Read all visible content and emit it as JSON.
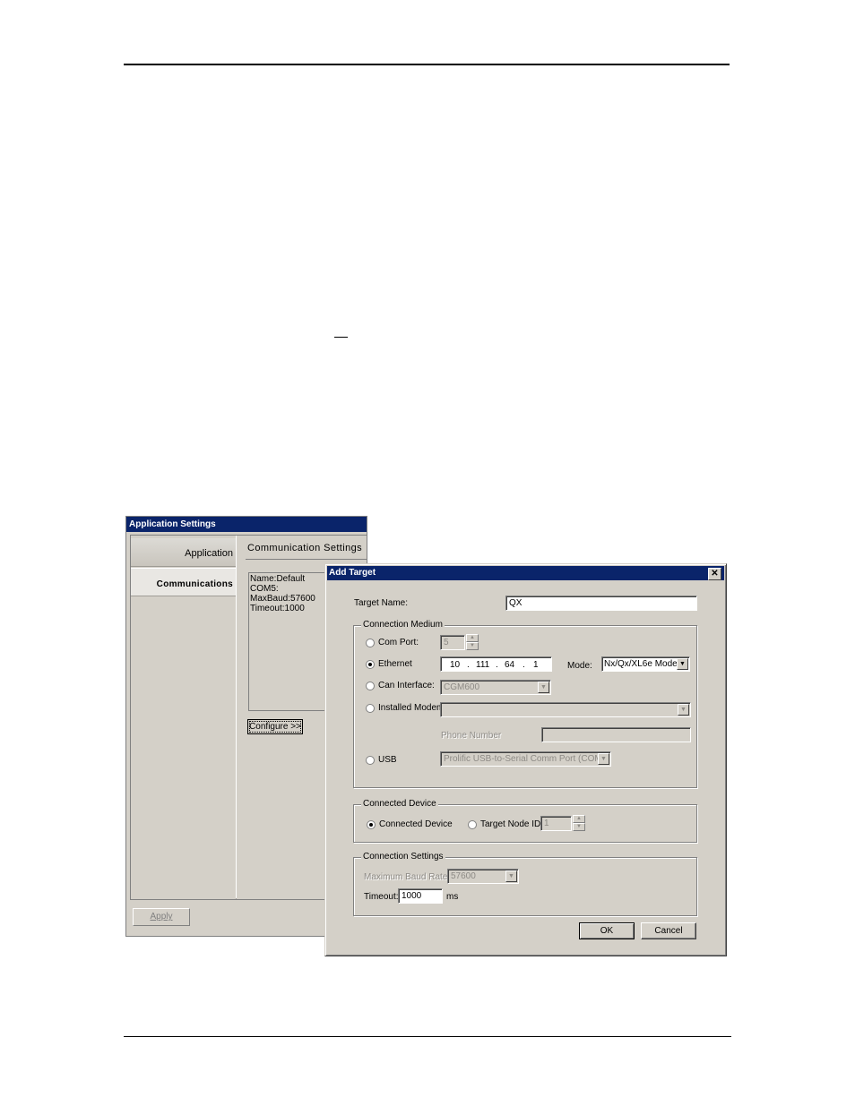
{
  "app_settings": {
    "title": "Application Settings",
    "tabs": [
      {
        "label": "Application"
      },
      {
        "label": "Communications"
      }
    ],
    "panel_header": "Communication Settings",
    "info_lines": [
      "Name:Default",
      "COM5:",
      "MaxBaud:57600",
      "Timeout:1000"
    ],
    "configure_label": "Configure >>",
    "apply_label": "Apply"
  },
  "add_target": {
    "title": "Add Target",
    "close_glyph": "✕",
    "target_name_label": "Target Name:",
    "target_name_value": "QX",
    "connection_medium": {
      "title": "Connection Medium",
      "com_port_label": "Com Port:",
      "com_port_value": "5",
      "ethernet_label": "Ethernet",
      "ip": [
        "10",
        "111",
        "64",
        "1"
      ],
      "ip_sep": ".",
      "mode_label": "Mode:",
      "mode_value": "Nx/Qx/XL6e Mode",
      "can_label": "Can Interface:",
      "can_value": "CGM600",
      "modem_label": "Installed Modem",
      "modem_value": "",
      "phone_label": "Phone Number",
      "phone_value": "",
      "usb_label": "USB",
      "usb_value": "Prolific USB-to-Serial Comm Port (COM5)",
      "selected": "ethernet"
    },
    "connected_device": {
      "title": "Connected Device",
      "connected_label": "Connected Device",
      "node_label": "Target Node ID",
      "node_value": "1",
      "selected": "connected"
    },
    "connection_settings": {
      "title": "Connection Settings",
      "baud_label": "Maximum Baud Rate:",
      "baud_value": "57600",
      "timeout_label": "Timeout:",
      "timeout_value": "1000",
      "timeout_unit": "ms"
    },
    "ok_label": "OK",
    "cancel_label": "Cancel"
  },
  "icons": {
    "dropdown_arrow": "▼",
    "spin_up": "▲",
    "spin_down": "▼"
  }
}
